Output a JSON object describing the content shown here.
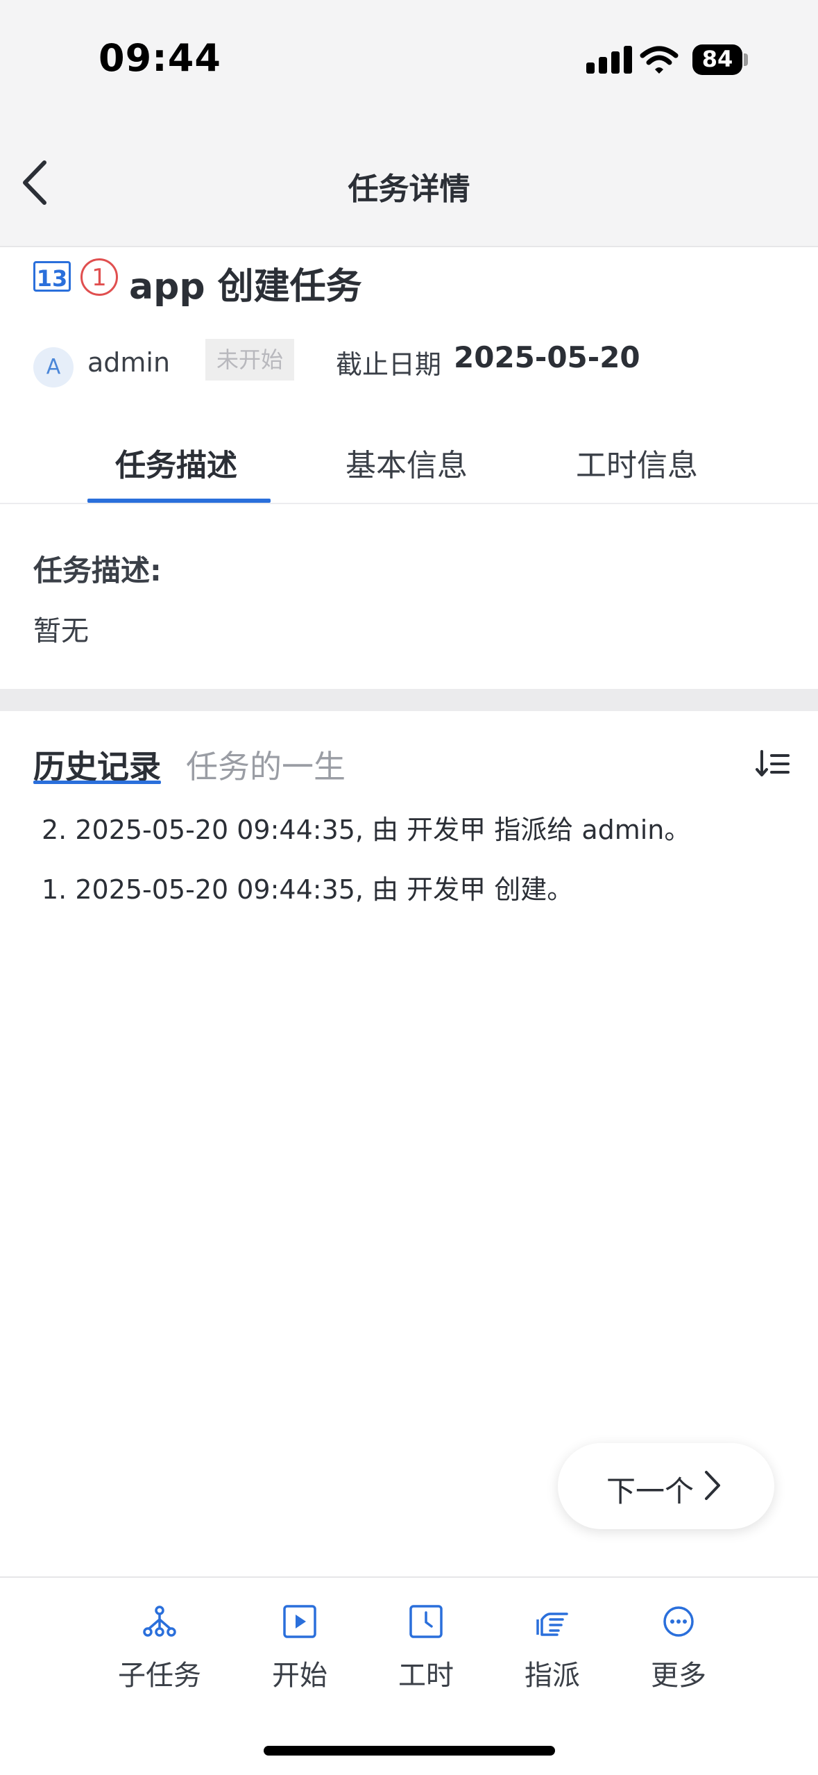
{
  "status_bar": {
    "time": "09:44",
    "battery": "84"
  },
  "nav": {
    "title": "任务详情"
  },
  "task": {
    "id": "13",
    "priority": "1",
    "title": "app 创建任务",
    "assignee_initial": "A",
    "assignee": "admin",
    "status": "未开始",
    "deadline_label": "截止日期",
    "deadline": "2025-05-20"
  },
  "tabs": [
    {
      "label": "任务描述",
      "active": true
    },
    {
      "label": "基本信息",
      "active": false
    },
    {
      "label": "工时信息",
      "active": false
    }
  ],
  "description": {
    "label": "任务描述:",
    "value": "暂无"
  },
  "history": {
    "tab_active": "历史记录",
    "tab_other": "任务的一生",
    "items": [
      "2.  2025-05-20 09:44:35, 由 开发甲 指派给 admin。",
      "1.  2025-05-20 09:44:35, 由 开发甲 创建。"
    ]
  },
  "next_button": {
    "label": "下一个"
  },
  "bottom_bar": [
    {
      "label": "子任务",
      "icon": "subtask-icon"
    },
    {
      "label": "开始",
      "icon": "play-icon"
    },
    {
      "label": "工时",
      "icon": "clock-icon"
    },
    {
      "label": "指派",
      "icon": "assign-hand-icon"
    },
    {
      "label": "更多",
      "icon": "more-icon"
    }
  ],
  "colors": {
    "accent": "#2a6fdb",
    "priority": "#e04f4f"
  }
}
